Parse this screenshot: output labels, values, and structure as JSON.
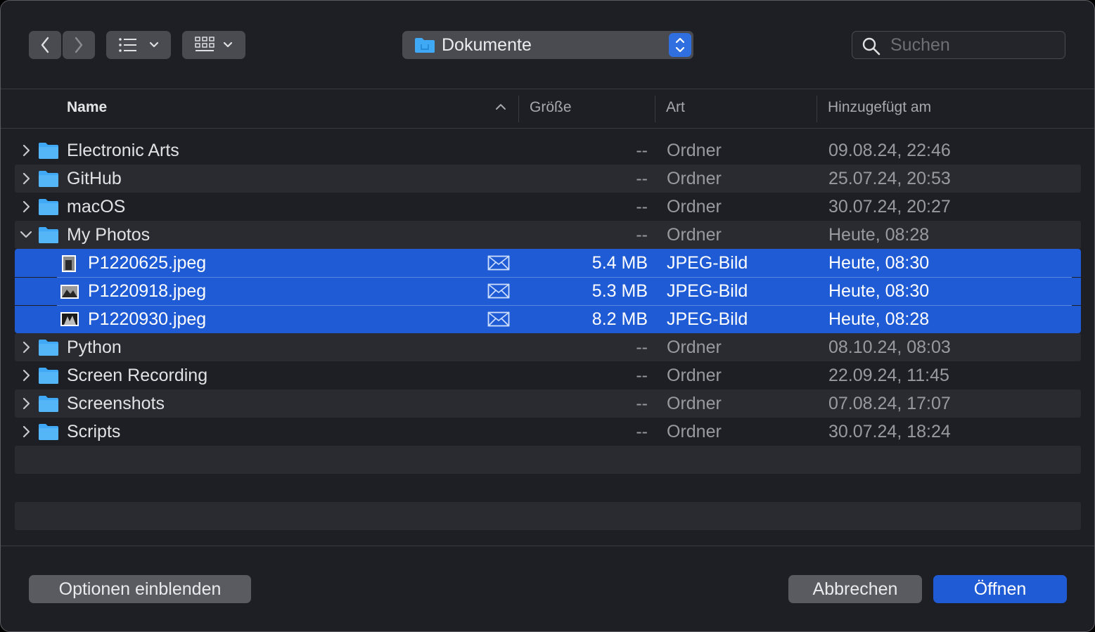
{
  "toolbar": {
    "location": "Dokumente",
    "search_placeholder": "Suchen"
  },
  "columns": {
    "name": "Name",
    "size": "Größe",
    "kind": "Art",
    "date_added": "Hinzugefügt am"
  },
  "rows": [
    {
      "name": "Electronic Arts",
      "size": "--",
      "kind": "Ordner",
      "date": "09.08.24, 22:46"
    },
    {
      "name": "GitHub",
      "size": "--",
      "kind": "Ordner",
      "date": "25.07.24, 20:53"
    },
    {
      "name": "macOS",
      "size": "--",
      "kind": "Ordner",
      "date": "30.07.24, 20:27"
    },
    {
      "name": "My Photos",
      "size": "--",
      "kind": "Ordner",
      "date": "Heute, 08:28"
    },
    {
      "name": "P1220625.jpeg",
      "size": "5.4 MB",
      "kind": "JPEG-Bild",
      "date": "Heute, 08:30"
    },
    {
      "name": "P1220918.jpeg",
      "size": "5.3 MB",
      "kind": "JPEG-Bild",
      "date": "Heute, 08:30"
    },
    {
      "name": "P1220930.jpeg",
      "size": "8.2 MB",
      "kind": "JPEG-Bild",
      "date": "Heute, 08:28"
    },
    {
      "name": "Python",
      "size": "--",
      "kind": "Ordner",
      "date": "08.10.24, 08:03"
    },
    {
      "name": "Screen Recording",
      "size": "--",
      "kind": "Ordner",
      "date": "22.09.24, 11:45"
    },
    {
      "name": "Screenshots",
      "size": "--",
      "kind": "Ordner",
      "date": "07.08.24, 17:07"
    },
    {
      "name": "Scripts",
      "size": "--",
      "kind": "Ordner",
      "date": "30.07.24, 18:24"
    }
  ],
  "footer": {
    "options": "Optionen einblenden",
    "cancel": "Abbrechen",
    "open": "Öffnen"
  },
  "colors": {
    "accent": "#1f5bd4",
    "folder": "#3fa9f5"
  }
}
